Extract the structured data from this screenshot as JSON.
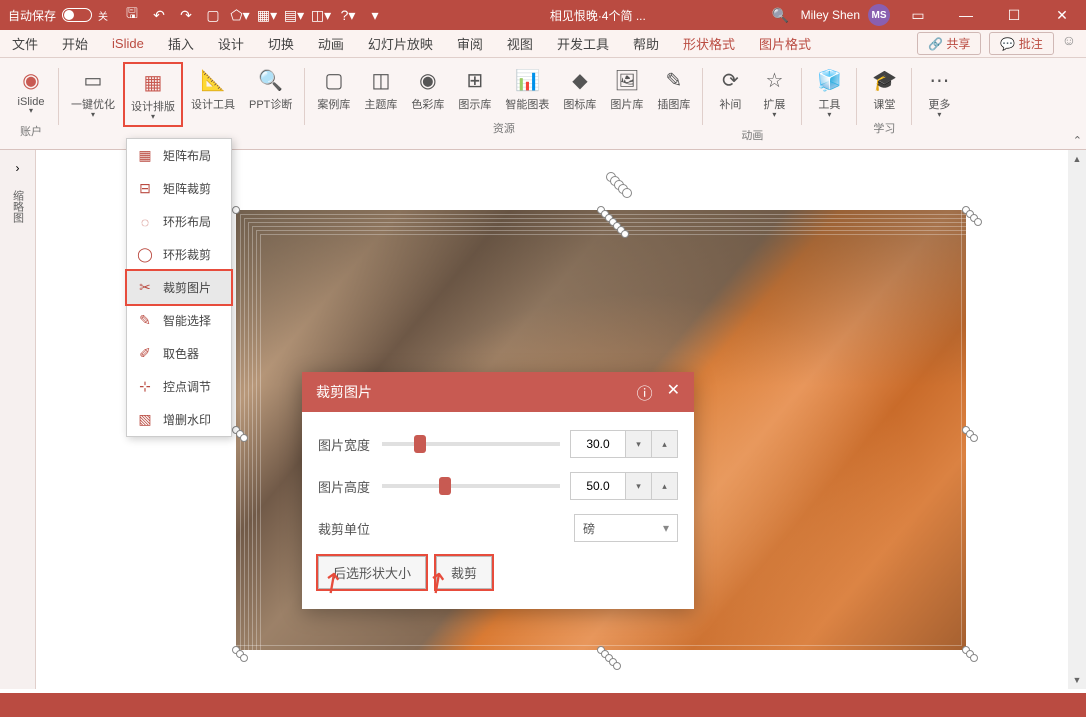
{
  "titlebar": {
    "autosave": "自动保存",
    "toggle_state": "关",
    "doc_title": "相见恨晚·4个简 ...",
    "user": "Miley Shen",
    "avatar": "MS"
  },
  "tabs": {
    "items": [
      "文件",
      "开始",
      "iSlide",
      "插入",
      "设计",
      "切换",
      "动画",
      "幻灯片放映",
      "审阅",
      "视图",
      "开发工具",
      "帮助",
      "形状格式",
      "图片格式"
    ],
    "active": "iSlide",
    "share": "共享",
    "comment": "批注"
  },
  "ribbon": {
    "islide": {
      "label": "iSlide",
      "account": "账户"
    },
    "onekey": {
      "label": "一键优化"
    },
    "design_layout": {
      "label": "设计排版"
    },
    "design_tool": {
      "label": "设计工具"
    },
    "ppt_diag": {
      "label": "PPT诊断"
    },
    "case": {
      "label": "案例库"
    },
    "theme": {
      "label": "主题库"
    },
    "color": {
      "label": "色彩库"
    },
    "diagram": {
      "label": "图示库"
    },
    "smartchart": {
      "label": "智能图表"
    },
    "iconlib": {
      "label": "图标库"
    },
    "photo": {
      "label": "图片库"
    },
    "illust": {
      "label": "插图库"
    },
    "tween": {
      "label": "补间"
    },
    "extend": {
      "label": "扩展"
    },
    "tools": {
      "label": "工具"
    },
    "course": {
      "label": "课堂"
    },
    "more": {
      "label": "更多"
    },
    "group_resource": "资源",
    "group_anim": "动画",
    "group_learn": "学习"
  },
  "menu": {
    "items": [
      "矩阵布局",
      "矩阵裁剪",
      "环形布局",
      "环形裁剪",
      "裁剪图片",
      "智能选择",
      "取色器",
      "控点调节",
      "增删水印"
    ],
    "selected": "裁剪图片"
  },
  "dialog": {
    "title": "裁剪图片",
    "width_label": "图片宽度",
    "width_value": "30.0",
    "height_label": "图片高度",
    "height_value": "50.0",
    "unit_label": "裁剪单位",
    "unit_value": "磅",
    "btn_resize": "后选形状大小",
    "btn_crop": "裁剪"
  },
  "side": {
    "outline": "缩略图"
  }
}
